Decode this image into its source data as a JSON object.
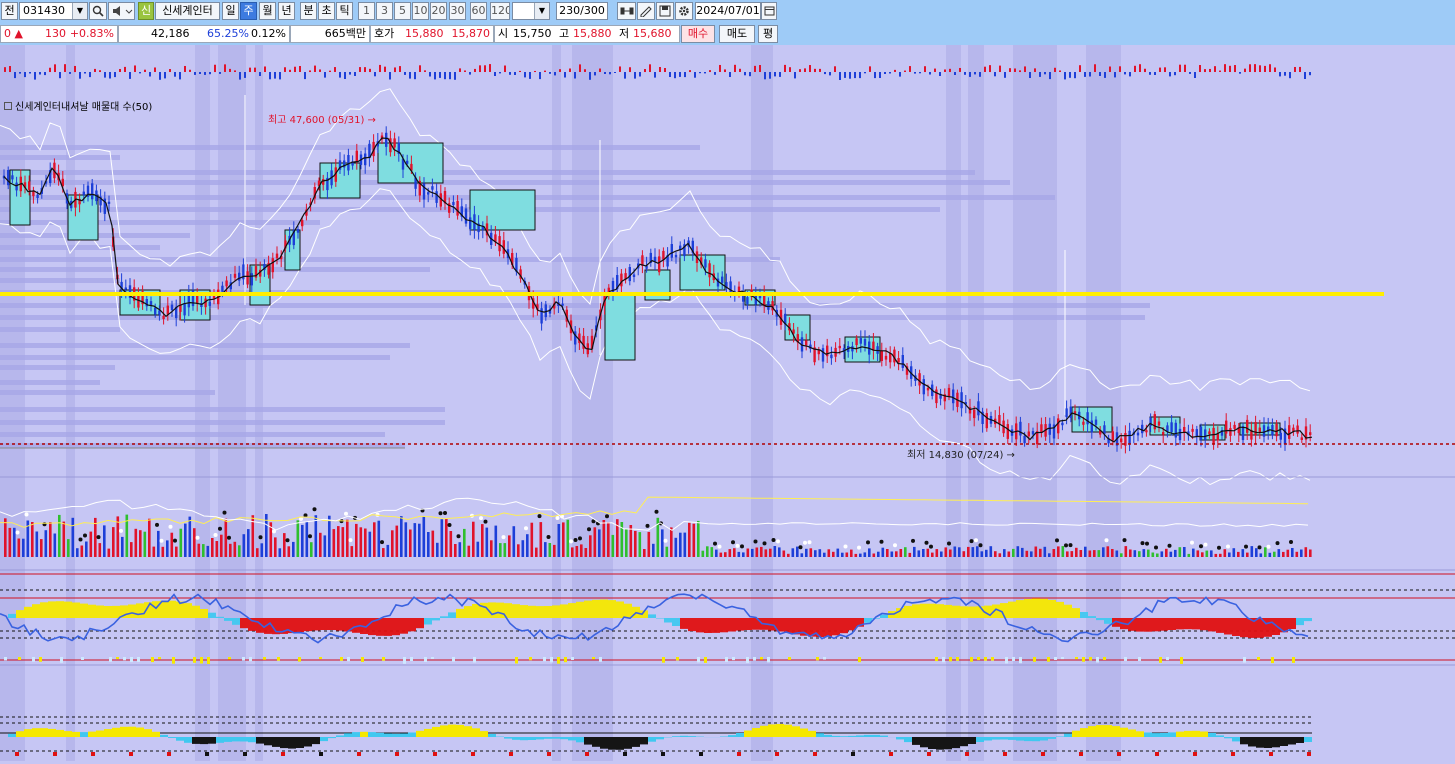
{
  "toolbar": {
    "mode_label": "전",
    "code": "031430",
    "badge": "신",
    "stock_name": "신세계인터",
    "periods": [
      "일",
      "주",
      "월",
      "년",
      "분",
      "초",
      "틱"
    ],
    "selected_period": "주",
    "intervals": [
      "1",
      "3",
      "5",
      "10",
      "20",
      "30",
      "60",
      "120"
    ],
    "count": "230",
    "count_total": "/300",
    "date": "2024/07/01"
  },
  "quote": {
    "prev_label": "0",
    "change_arrow": "▲",
    "change": "130",
    "change_pct": "+0.83%",
    "volume": "42,186",
    "ratio": "65.25%",
    "turnover": "0.12%",
    "amount": "665백만",
    "bid_label": "호가",
    "ask_price": "15,880",
    "bid_price": "15,870",
    "open_label": "시",
    "open": "15,750",
    "high_label": "고",
    "high": "15,880",
    "low_label": "저",
    "low": "15,680",
    "buy_label": "매수",
    "sell_label": "매도",
    "eval_label": "평"
  },
  "chart": {
    "indicator_title": "신세계인터내셔날 매물대 수(50)",
    "high_note": "최고 47,600 (05/31)",
    "low_note": "최저 14,830 (07/24)",
    "colors": {
      "bg": "#c6c6f4",
      "band": "#b3b3ea",
      "up": "#e0132b",
      "down": "#1d3fd8",
      "cloud": "#7fdde0",
      "yellow_line": "#ffee00",
      "profile": "#a8a8e8"
    }
  }
}
